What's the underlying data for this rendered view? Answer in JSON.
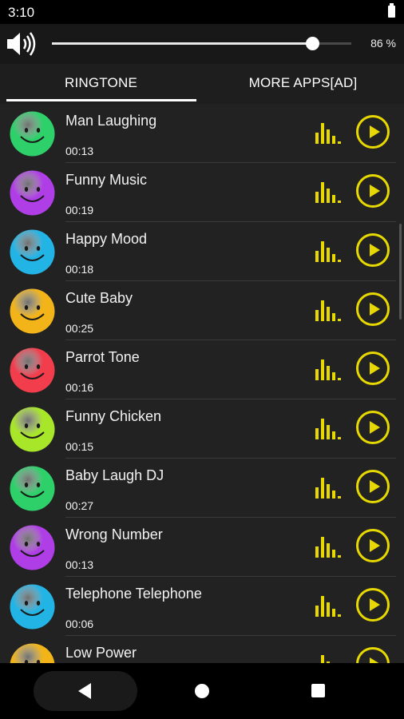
{
  "status": {
    "time": "3:10"
  },
  "volume": {
    "percent_label": "86 %",
    "level": 0.87
  },
  "tabs": [
    {
      "label": "RINGTONE",
      "selected": true
    },
    {
      "label": "MORE APPS[AD]",
      "selected": false
    }
  ],
  "colors": {
    "accent": "#e6d800",
    "avatars": [
      "#2ed06a",
      "#b03ee6",
      "#23b4e6",
      "#f2b418",
      "#f23d4d",
      "#a8e62a",
      "#2ed06a",
      "#b03ee6",
      "#23b4e6",
      "#f2b418"
    ]
  },
  "ringtones": [
    {
      "title": "Man Laughing",
      "duration": "00:13"
    },
    {
      "title": "Funny Music",
      "duration": "00:19"
    },
    {
      "title": "Happy Mood",
      "duration": "00:18"
    },
    {
      "title": "Cute Baby",
      "duration": "00:25"
    },
    {
      "title": "Parrot Tone",
      "duration": "00:16"
    },
    {
      "title": "Funny Chicken",
      "duration": "00:15"
    },
    {
      "title": "Baby Laugh DJ",
      "duration": "00:27"
    },
    {
      "title": "Wrong Number",
      "duration": "00:13"
    },
    {
      "title": "Telephone Telephone",
      "duration": "00:06"
    },
    {
      "title": "Low Power",
      "duration": ""
    }
  ],
  "icons": {
    "speaker": "speaker-icon",
    "bars": "equalizer-icon",
    "play": "play-icon",
    "avatar": "smiley-face-icon",
    "nav_back": "back-icon",
    "nav_home": "home-icon",
    "nav_recent": "recents-icon"
  }
}
